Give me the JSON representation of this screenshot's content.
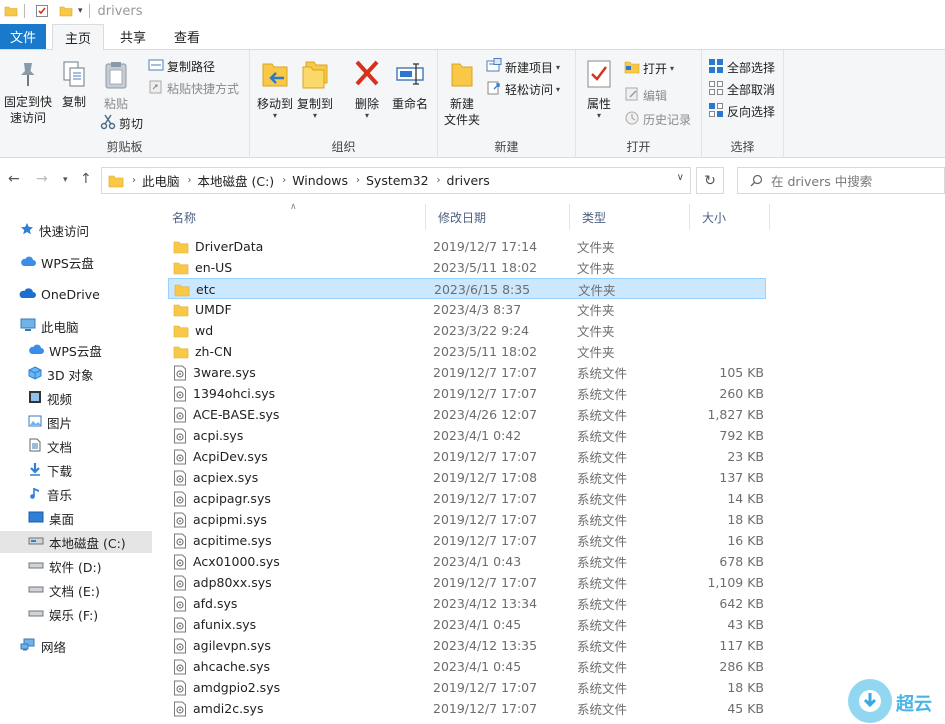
{
  "titlebar": {
    "title": "drivers"
  },
  "tabs": [
    {
      "label": "文件"
    },
    {
      "label": "主页"
    },
    {
      "label": "共享"
    },
    {
      "label": "查看"
    }
  ],
  "ribbon": {
    "clipboard": {
      "pin_label_1": "固定到快",
      "pin_label_2": "速访问",
      "copy": "复制",
      "paste": "粘贴",
      "copy_path": "复制路径",
      "paste_shortcut": "粘贴快捷方式",
      "cut": "剪切",
      "group": "剪贴板"
    },
    "organize": {
      "move_to": "移动到",
      "copy_to": "复制到",
      "delete": "删除",
      "rename": "重命名",
      "group": "组织"
    },
    "new": {
      "new_folder_1": "新建",
      "new_folder_2": "文件夹",
      "new_item": "新建项目",
      "easy_access": "轻松访问",
      "group": "新建"
    },
    "open": {
      "properties": "属性",
      "open": "打开",
      "edit": "编辑",
      "history": "历史记录",
      "group": "打开"
    },
    "select": {
      "select_all": "全部选择",
      "select_none": "全部取消",
      "invert": "反向选择",
      "group": "选择"
    }
  },
  "address": {
    "crumbs": [
      "此电脑",
      "本地磁盘 (C:)",
      "Windows",
      "System32",
      "drivers"
    ],
    "search_placeholder": "在 drivers 中搜索"
  },
  "sidebar": {
    "items": [
      {
        "label": "快速访问",
        "icon": "star-icon"
      },
      {
        "label": "WPS云盘",
        "icon": "cloud-icon"
      },
      {
        "label": "OneDrive",
        "icon": "onedrive-icon"
      },
      {
        "label": "此电脑",
        "icon": "computer-icon"
      },
      {
        "label": "WPS云盘",
        "icon": "cloud-icon"
      },
      {
        "label": "3D 对象",
        "icon": "cube-icon"
      },
      {
        "label": "视频",
        "icon": "video-icon"
      },
      {
        "label": "图片",
        "icon": "picture-icon"
      },
      {
        "label": "文档",
        "icon": "document-icon"
      },
      {
        "label": "下载",
        "icon": "download-icon"
      },
      {
        "label": "音乐",
        "icon": "music-icon"
      },
      {
        "label": "桌面",
        "icon": "desktop-icon"
      },
      {
        "label": "本地磁盘 (C:)",
        "icon": "drive-icon"
      },
      {
        "label": "软件 (D:)",
        "icon": "drive-icon"
      },
      {
        "label": "文档 (E:)",
        "icon": "drive-icon"
      },
      {
        "label": "娱乐 (F:)",
        "icon": "drive-icon"
      },
      {
        "label": "网络",
        "icon": "network-icon"
      }
    ]
  },
  "list": {
    "columns": {
      "name": "名称",
      "date": "修改日期",
      "type": "类型",
      "size": "大小"
    },
    "rows": [
      {
        "name": "DriverData",
        "date": "2019/12/7 17:14",
        "type": "文件夹",
        "size": "",
        "kind": "folder"
      },
      {
        "name": "en-US",
        "date": "2023/5/11 18:02",
        "type": "文件夹",
        "size": "",
        "kind": "folder"
      },
      {
        "name": "etc",
        "date": "2023/6/15 8:35",
        "type": "文件夹",
        "size": "",
        "kind": "folder"
      },
      {
        "name": "UMDF",
        "date": "2023/4/3 8:37",
        "type": "文件夹",
        "size": "",
        "kind": "folder"
      },
      {
        "name": "wd",
        "date": "2023/3/22 9:24",
        "type": "文件夹",
        "size": "",
        "kind": "folder"
      },
      {
        "name": "zh-CN",
        "date": "2023/5/11 18:02",
        "type": "文件夹",
        "size": "",
        "kind": "folder"
      },
      {
        "name": "3ware.sys",
        "date": "2019/12/7 17:07",
        "type": "系统文件",
        "size": "105 KB",
        "kind": "sys"
      },
      {
        "name": "1394ohci.sys",
        "date": "2019/12/7 17:07",
        "type": "系统文件",
        "size": "260 KB",
        "kind": "sys"
      },
      {
        "name": "ACE-BASE.sys",
        "date": "2023/4/26 12:07",
        "type": "系统文件",
        "size": "1,827 KB",
        "kind": "sys"
      },
      {
        "name": "acpi.sys",
        "date": "2023/4/1 0:42",
        "type": "系统文件",
        "size": "792 KB",
        "kind": "sys"
      },
      {
        "name": "AcpiDev.sys",
        "date": "2019/12/7 17:07",
        "type": "系统文件",
        "size": "23 KB",
        "kind": "sys"
      },
      {
        "name": "acpiex.sys",
        "date": "2019/12/7 17:08",
        "type": "系统文件",
        "size": "137 KB",
        "kind": "sys"
      },
      {
        "name": "acpipagr.sys",
        "date": "2019/12/7 17:07",
        "type": "系统文件",
        "size": "14 KB",
        "kind": "sys"
      },
      {
        "name": "acpipmi.sys",
        "date": "2019/12/7 17:07",
        "type": "系统文件",
        "size": "18 KB",
        "kind": "sys"
      },
      {
        "name": "acpitime.sys",
        "date": "2019/12/7 17:07",
        "type": "系统文件",
        "size": "16 KB",
        "kind": "sys"
      },
      {
        "name": "Acx01000.sys",
        "date": "2023/4/1 0:43",
        "type": "系统文件",
        "size": "678 KB",
        "kind": "sys"
      },
      {
        "name": "adp80xx.sys",
        "date": "2019/12/7 17:07",
        "type": "系统文件",
        "size": "1,109 KB",
        "kind": "sys"
      },
      {
        "name": "afd.sys",
        "date": "2023/4/12 13:34",
        "type": "系统文件",
        "size": "642 KB",
        "kind": "sys"
      },
      {
        "name": "afunix.sys",
        "date": "2023/4/1 0:45",
        "type": "系统文件",
        "size": "43 KB",
        "kind": "sys"
      },
      {
        "name": "agilevpn.sys",
        "date": "2023/4/12 13:35",
        "type": "系统文件",
        "size": "117 KB",
        "kind": "sys"
      },
      {
        "name": "ahcache.sys",
        "date": "2023/4/1 0:45",
        "type": "系统文件",
        "size": "286 KB",
        "kind": "sys"
      },
      {
        "name": "amdgpio2.sys",
        "date": "2019/12/7 17:07",
        "type": "系统文件",
        "size": "18 KB",
        "kind": "sys"
      },
      {
        "name": "amdi2c.sys",
        "date": "2019/12/7 17:07",
        "type": "系统文件",
        "size": "45 KB",
        "kind": "sys"
      }
    ],
    "selected_row": "etc"
  },
  "watermark": {
    "text": "超云"
  },
  "colors": {
    "accent": "#1979ca",
    "folder": "#f8c846",
    "selection": "#cce8ff"
  }
}
